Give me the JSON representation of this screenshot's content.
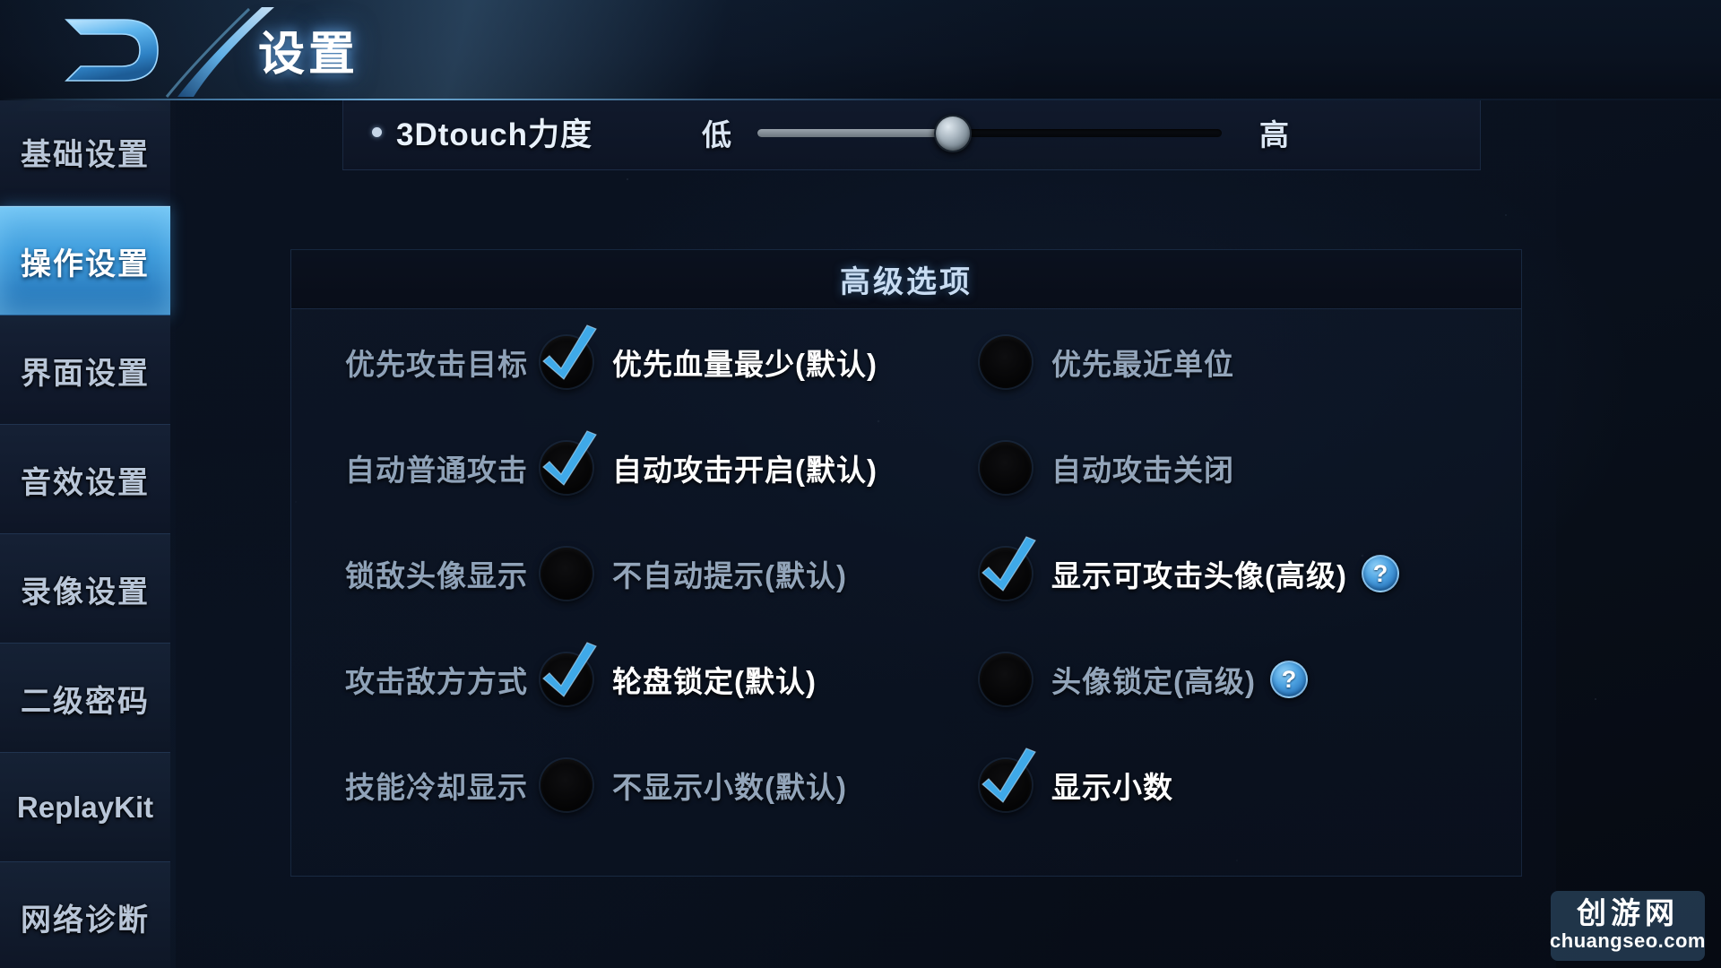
{
  "header": {
    "title": "设置",
    "logo_name": "game-logo-d"
  },
  "sidebar": {
    "items": [
      {
        "label": "基础设置",
        "active": false,
        "latin": false
      },
      {
        "label": "操作设置",
        "active": true,
        "latin": false
      },
      {
        "label": "界面设置",
        "active": false,
        "latin": false
      },
      {
        "label": "音效设置",
        "active": false,
        "latin": false
      },
      {
        "label": "录像设置",
        "active": false,
        "latin": false
      },
      {
        "label": "二级密码",
        "active": false,
        "latin": false
      },
      {
        "label": "ReplayKit",
        "active": false,
        "latin": true
      },
      {
        "label": "网络诊断",
        "active": false,
        "latin": false
      }
    ]
  },
  "slider_row": {
    "label": "3Dtouch力度",
    "min_label": "低",
    "max_label": "高",
    "value_percent": 42
  },
  "advanced": {
    "title": "高级选项",
    "rows": [
      {
        "label": "优先攻击目标",
        "left": {
          "text": "优先血量最少(默认)",
          "checked": true,
          "help": false
        },
        "right": {
          "text": "优先最近单位",
          "checked": false,
          "help": false
        }
      },
      {
        "label": "自动普通攻击",
        "left": {
          "text": "自动攻击开启(默认)",
          "checked": true,
          "help": false
        },
        "right": {
          "text": "自动攻击关闭",
          "checked": false,
          "help": false
        }
      },
      {
        "label": "锁敌头像显示",
        "left": {
          "text": "不自动提示(默认)",
          "checked": false,
          "help": false
        },
        "right": {
          "text": "显示可攻击头像(高级)",
          "checked": true,
          "help": true
        }
      },
      {
        "label": "攻击敌方方式",
        "left": {
          "text": "轮盘锁定(默认)",
          "checked": true,
          "help": false
        },
        "right": {
          "text": "头像锁定(高级)",
          "checked": false,
          "help": true
        }
      },
      {
        "label": "技能冷却显示",
        "left": {
          "text": "不显示小数(默认)",
          "checked": false,
          "help": false
        },
        "right": {
          "text": "显示小数",
          "checked": true,
          "help": false
        }
      }
    ],
    "help_glyph": "?"
  },
  "watermark": {
    "cn": "创游网",
    "url": "chuangseo.com"
  },
  "colors": {
    "accent": "#4ea3e2",
    "active_nav": "#3f9ddd",
    "panel_bg": "#0b1322",
    "checkmark": "#3fa9e8"
  }
}
